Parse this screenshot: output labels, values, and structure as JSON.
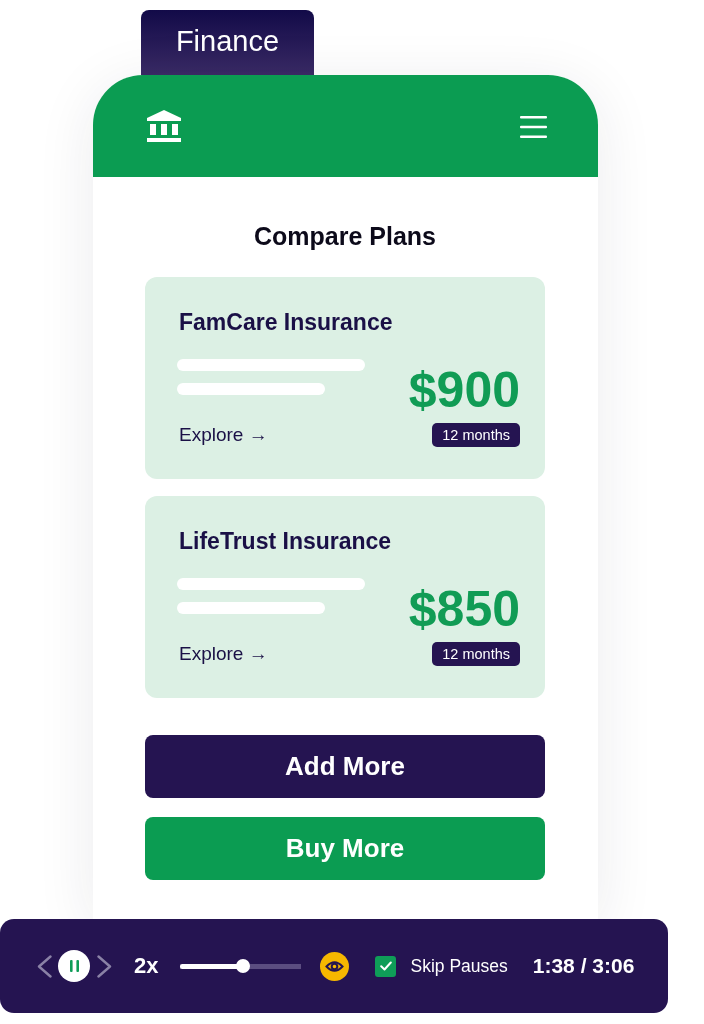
{
  "tab": {
    "label": "Finance"
  },
  "title": "Compare Plans",
  "plans": [
    {
      "name": "FamCare Insurance",
      "price": "$900",
      "link": "Explore →",
      "term": "12 months"
    },
    {
      "name": "LifeTrust Insurance",
      "price": "$850",
      "link": "Explore →",
      "term": "12 months"
    }
  ],
  "actions": [
    {
      "label": "Add More",
      "kind": "primary"
    },
    {
      "label": "Buy More",
      "kind": "confirm"
    }
  ],
  "player": {
    "playing": true,
    "speed": "2x",
    "level": 0.52,
    "skip_pauses": {
      "label": "Skip Pauses",
      "checked": true
    },
    "time": "1:38 / 3:06"
  }
}
